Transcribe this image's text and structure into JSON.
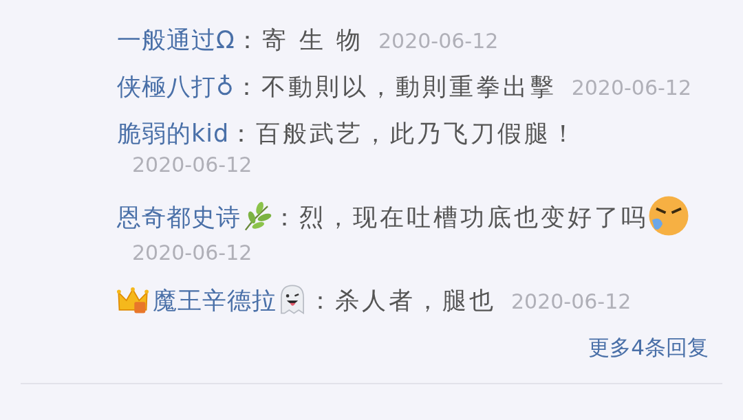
{
  "replies": [
    {
      "name": "一般通过Ω",
      "content": "：寄 生 物",
      "date": "2020-06-12"
    },
    {
      "name": "侠極八打♁",
      "content": "：不動則以，動則重拳出擊",
      "date": "2020-06-12"
    },
    {
      "name": "脆弱的kid",
      "content": "：百般武艺，此乃飞刀假腿！",
      "date": "2020-06-12"
    },
    {
      "name": "恩奇都史诗",
      "name_icons": [
        {
          "kind": "leaf"
        }
      ],
      "content": "：烈，现在吐槽功底也变好了吗",
      "stickers": [
        {
          "kind": "face"
        }
      ],
      "date": "2020-06-12"
    },
    {
      "name": "魔王辛德拉",
      "badges": [
        {
          "kind": "crown"
        }
      ],
      "name_icons": [
        {
          "kind": "ghost"
        }
      ],
      "content": "：杀人者，腿也",
      "date": "2020-06-12"
    }
  ],
  "more_link": "更多4条回复"
}
